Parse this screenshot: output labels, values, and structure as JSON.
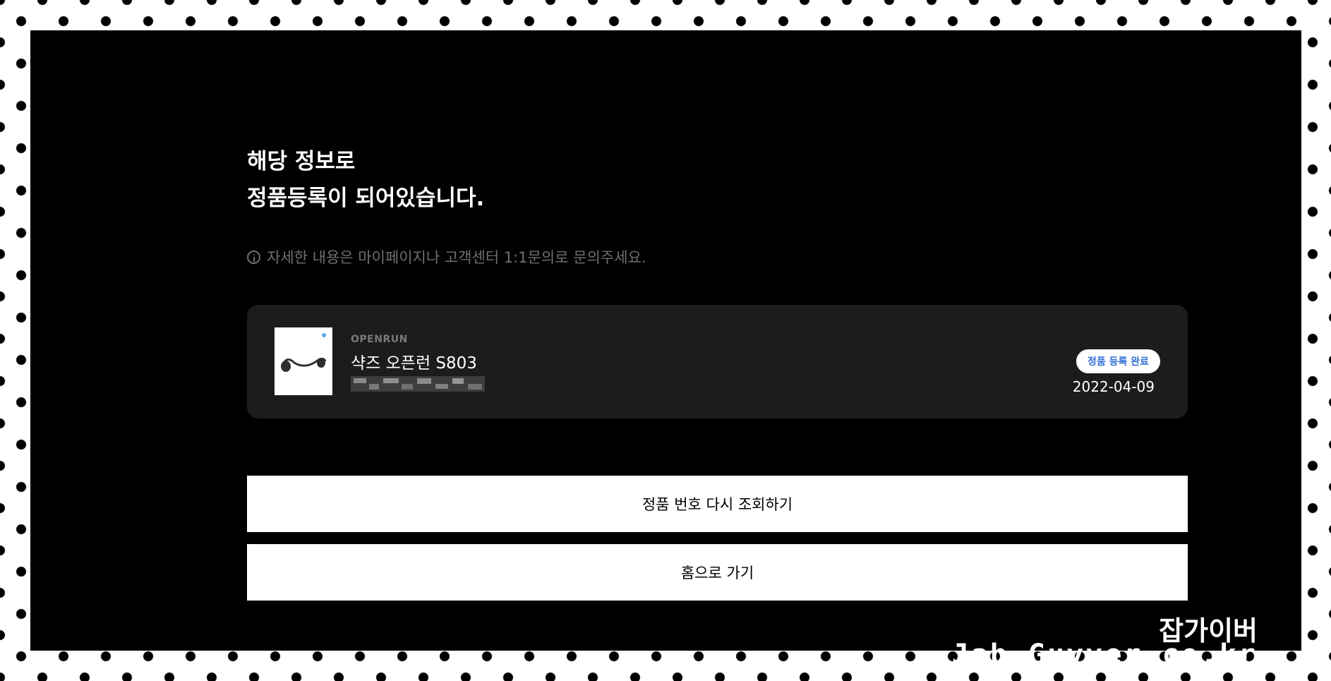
{
  "heading": {
    "line1": "해당 정보로",
    "line2": "정품등록이 되어있습니다."
  },
  "notice": {
    "text": "자세한 내용은 마이페이지나 고객센터 1:1문의로 문의주세요."
  },
  "product": {
    "brand": "OPENRUN",
    "name": "샥즈 오픈런 S803",
    "status_badge": "정품 등록 완료",
    "date": "2022-04-09"
  },
  "buttons": {
    "recheck": "정품 번호 다시 조회하기",
    "home": "홈으로 가기"
  },
  "watermark": {
    "line1": "잡가이버",
    "line2": "Jab-Guyver.co.kr"
  },
  "colors": {
    "panel": "#000000",
    "card": "#1c1c1c",
    "badge_text": "#2f6fd6",
    "notice_text": "#6f6f6f"
  }
}
